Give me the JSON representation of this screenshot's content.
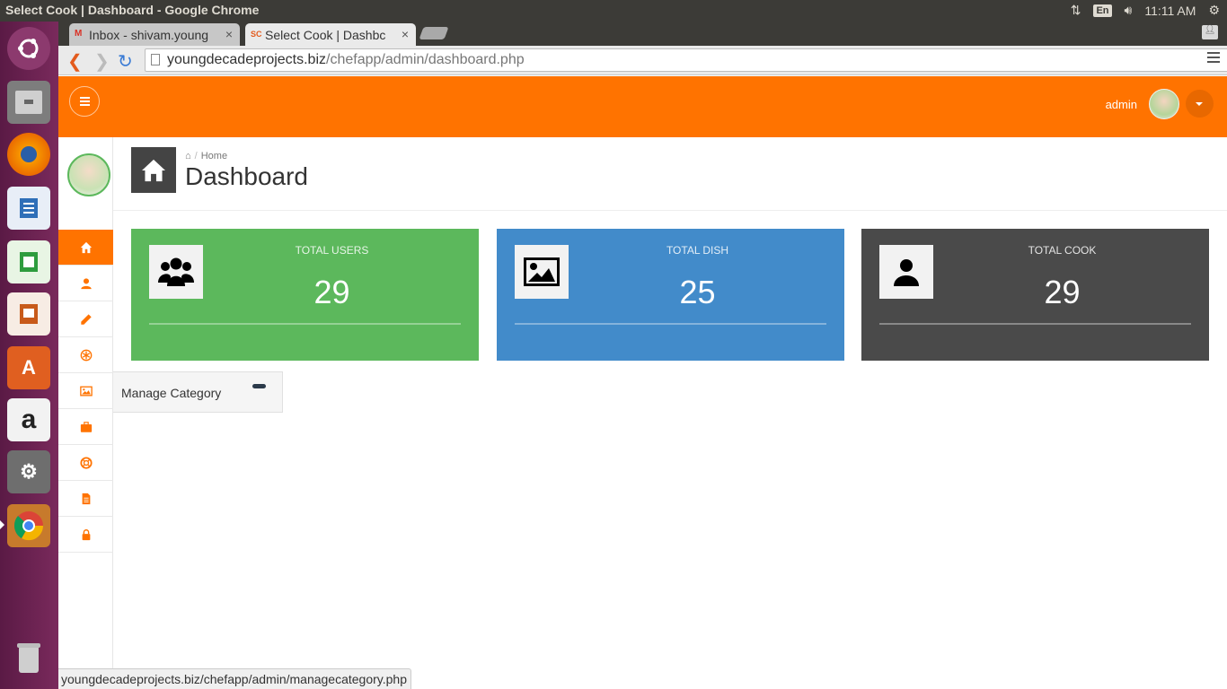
{
  "os": {
    "window_title": "Select Cook | Dashboard - Google Chrome",
    "lang": "En",
    "time": "11:11 AM"
  },
  "browser": {
    "tabs": [
      {
        "label": "Inbox - shivam.young",
        "favicon": "gmail-icon",
        "active": false
      },
      {
        "label": "Select Cook | Dashbc",
        "favicon": "sc-favicon",
        "active": true
      }
    ],
    "favicon_text": "SC",
    "url_host": "youngdecadeprojects.biz",
    "url_path": "/chefapp/admin/dashboard.php",
    "status_url": "youngdecadeprojects.biz/chefapp/admin/managecategory.php"
  },
  "header": {
    "admin_name": "admin"
  },
  "breadcrumb": {
    "home": "Home"
  },
  "page_title": "Dashboard",
  "sidebar": {
    "items": [
      {
        "icon": "home-icon",
        "active": true
      },
      {
        "icon": "user-icon",
        "active": false
      },
      {
        "icon": "pencil-icon",
        "active": false
      },
      {
        "icon": "asterisk-icon",
        "active": false
      },
      {
        "icon": "image-icon",
        "active": false
      },
      {
        "icon": "briefcase-icon",
        "active": false
      },
      {
        "icon": "lifebuoy-icon",
        "active": false
      },
      {
        "icon": "file-icon",
        "active": false
      },
      {
        "icon": "lock-icon",
        "active": false
      }
    ],
    "hover_label": "Manage Category"
  },
  "cards": [
    {
      "label": "TOTAL USERS",
      "value": "29",
      "color": "#5cb85c",
      "icon": "users-icon"
    },
    {
      "label": "TOTAL DISH",
      "value": "25",
      "color": "#428bca",
      "icon": "picture-icon"
    },
    {
      "label": "TOTAL COOK",
      "value": "29",
      "color": "#4a4a4a",
      "icon": "person-icon"
    }
  ],
  "colors": {
    "accent": "#ff7300",
    "launcher": "#6b1f50"
  }
}
